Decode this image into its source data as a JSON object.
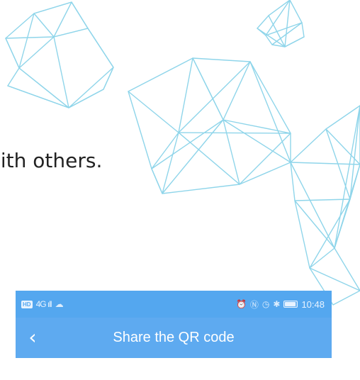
{
  "slide": {
    "text": "with others."
  },
  "statusbar": {
    "left_badge": "HD",
    "left_signal": "4G ıll",
    "left_icon": "cloud-icon",
    "right_icons": [
      "alarm-icon",
      "nfc-icon",
      "clock-icon",
      "bluetooth-icon"
    ],
    "time": "10:48"
  },
  "header": {
    "back_icon": "chevron-left-icon",
    "title": "Share the QR code"
  },
  "colors": {
    "status_blue": "#54a7ef",
    "header_blue": "#5eaaf0",
    "line_blue": "#8fd5ea",
    "text_dark": "#222222"
  }
}
